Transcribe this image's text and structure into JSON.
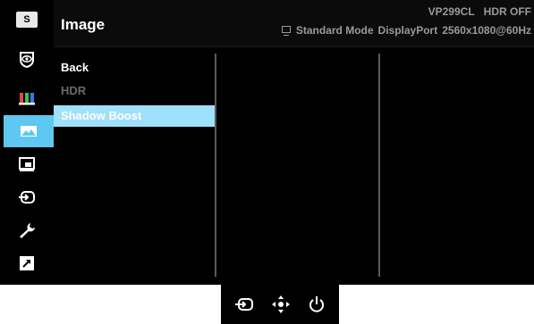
{
  "header": {
    "title": "Image",
    "model": "VP299CL",
    "hdr_status": "HDR OFF",
    "mode": "Standard Mode",
    "input": "DisplayPort",
    "resolution": "2560x1080@60Hz"
  },
  "sidebar": {
    "logo_letter": "S",
    "items": [
      {
        "icon": "splendid-eye-icon"
      },
      {
        "icon": "color-bars-icon"
      },
      {
        "icon": "image-icon",
        "active": true
      },
      {
        "icon": "pip-icon"
      },
      {
        "icon": "input-select-icon"
      },
      {
        "icon": "wrench-icon"
      },
      {
        "icon": "shortcut-icon"
      }
    ]
  },
  "menu": {
    "items": [
      {
        "label": "Back",
        "state": "normal"
      },
      {
        "label": "HDR",
        "state": "disabled"
      },
      {
        "label": "Shadow Boost",
        "state": "selected"
      }
    ]
  },
  "colors": {
    "accent": "#5ec8f2",
    "selected_row": "#9fe0fa",
    "background": "#000000"
  },
  "keys": [
    {
      "icon": "input-key-icon"
    },
    {
      "icon": "joystick-key-icon"
    },
    {
      "icon": "power-key-icon"
    }
  ]
}
